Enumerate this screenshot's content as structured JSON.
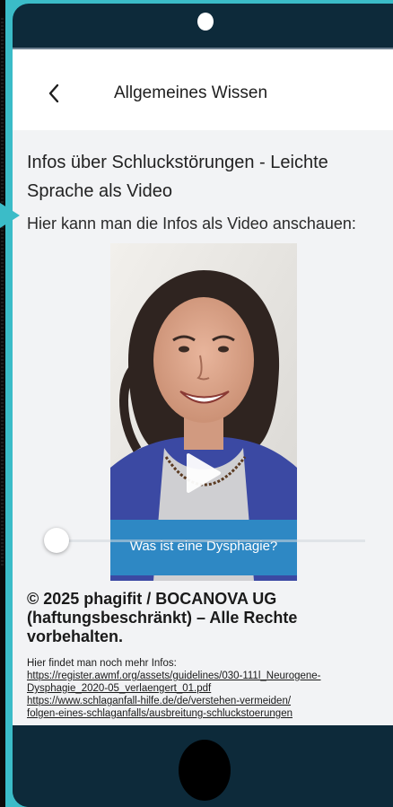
{
  "header": {
    "title": "Allgemeines Wissen"
  },
  "content": {
    "section_title": "Infos über Schluckstörungen  - Leichte Sprache als Video",
    "intro": "Hier kann man die Infos als Video anschauen:",
    "video": {
      "caption": "Was ist eine Dysphagie?",
      "progress": 0.03
    },
    "copyright": "© 2025 phagifit / BOCANOVA UG (haftungsbeschränkt) – Alle Rechte vorbehalten.",
    "more_info_label": "Hier findet man noch mehr Infos:",
    "links": [
      "https://register.awmf.org/assets/guidelines/030-111l_Neurogene-",
      "Dysphagie_2020-05_verlaengert_01.pdf",
      "https://www.schlaganfall-hilfe.de/de/verstehen-vermeiden/",
      "folgen-eines-schlaganfalls/ausbreitung-schluckstoerungen"
    ]
  },
  "colors": {
    "background": "#3bbcc8",
    "bezel": "#0d2a3a",
    "caption_bar": "#2e88c4"
  }
}
